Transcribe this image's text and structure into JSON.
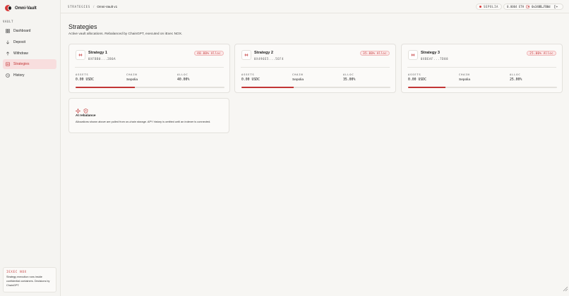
{
  "app": {
    "name": "Omni-Vault"
  },
  "sidebar": {
    "section_label": "VAULT",
    "items": [
      {
        "label": "Dashboard",
        "icon": "grid-icon",
        "active": false
      },
      {
        "label": "Deposit",
        "icon": "arrow-down-icon",
        "active": false
      },
      {
        "label": "Withdraw",
        "icon": "arrow-up-icon",
        "active": false
      },
      {
        "label": "Strategies",
        "icon": "layers-icon",
        "active": true
      },
      {
        "label": "History",
        "icon": "clock-icon",
        "active": false
      }
    ],
    "footer": {
      "tag": "IEXEC NOX",
      "text": "Strategy execution runs inside confidential containers. Decisions by ChainGPT."
    }
  },
  "topbar": {
    "breadcrumb_root": "STRATEGIES",
    "breadcrumb_sep": "/",
    "breadcrumb_current": "Omni-Vault v1",
    "network": "SEPOLIA",
    "balance": "0.0004 ETH",
    "address": "0x348B…FB0d"
  },
  "page": {
    "title": "Strategies",
    "subtitle": "Active vault allocations. Rebalanced by ChainGPT, executed on iExec NOX."
  },
  "strategies": [
    {
      "name": "Strategy 1",
      "address": "0XFBB0...2B0A",
      "alloc_pill": "40.00% Alloc",
      "assets_label": "ASSETS",
      "assets": "0.00 USDC",
      "chain_label": "CHAIN",
      "chain": "Sepolia",
      "alloc_label": "ALLOC",
      "alloc": "40.00%",
      "alloc_fraction": 0.4
    },
    {
      "name": "Strategy 2",
      "address": "0X496E5...5EF4",
      "alloc_pill": "35.00% Alloc",
      "assets_label": "ASSETS",
      "assets": "0.00 USDC",
      "chain_label": "CHAIN",
      "chain": "Sepolia",
      "alloc_label": "ALLOC",
      "alloc": "35.00%",
      "alloc_fraction": 0.35
    },
    {
      "name": "Strategy 3",
      "address": "0XBEAF...7D88",
      "alloc_pill": "25.00% Alloc",
      "assets_label": "ASSETS",
      "assets": "0.00 USDC",
      "chain_label": "CHAIN",
      "chain": "Sepolia",
      "alloc_label": "ALLOC",
      "alloc": "25.00%",
      "alloc_fraction": 0.25
    }
  ],
  "ai_card": {
    "title": "AI rebalance",
    "description": "Allocations shown above are pulled from on-chain storage. APY history is omitted until an indexer is connected.",
    "icons": [
      "sparkle-icon",
      "shield-icon"
    ]
  },
  "colors": {
    "accent": "#c23535",
    "accent_bg": "#f8dede",
    "background": "#f7f6f3"
  }
}
